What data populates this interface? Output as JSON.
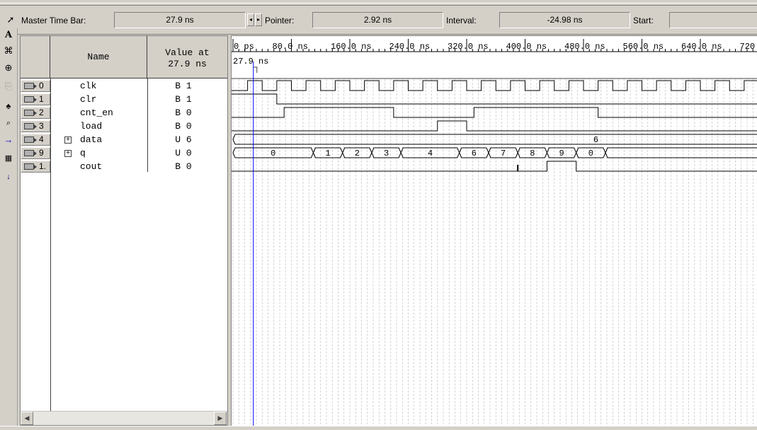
{
  "header": {
    "master_time_bar_label": "Master Time Bar:",
    "master_time_bar_value": "27.9 ns",
    "pointer_label": "Pointer:",
    "pointer_value": "2.92 ns",
    "interval_label": "Interval:",
    "interval_value": "-24.98 ns",
    "start_label": "Start:",
    "start_value": ""
  },
  "table": {
    "col_name": "Name",
    "col_value_line1": "Value at",
    "col_value_line2": "27.9 ns"
  },
  "signals": [
    {
      "index": "0",
      "name": "clk",
      "value": "B 1",
      "group": false
    },
    {
      "index": "1",
      "name": "clr",
      "value": "B 1",
      "group": false
    },
    {
      "index": "2",
      "name": "cnt_en",
      "value": "B 0",
      "group": false
    },
    {
      "index": "3",
      "name": "load",
      "value": "B 0",
      "group": false
    },
    {
      "index": "4",
      "name": "data",
      "value": "U 6",
      "group": true
    },
    {
      "index": "9",
      "name": "q",
      "value": "U 0",
      "group": true
    },
    {
      "index": "1.",
      "name": "cout",
      "value": "B 0",
      "group": false
    }
  ],
  "timeline": {
    "ticks": [
      "0 ps",
      "80.0 ns",
      "160.0 ns",
      "240.0 ns",
      "320.0 ns",
      "400.0 ns",
      "480.0 ns",
      "560.0 ns",
      "640.0 ns",
      "720."
    ],
    "cursor_label": "27.9 ns",
    "data_bus_value": "6",
    "q_bus_values": [
      "0",
      "1",
      "2",
      "3",
      "4",
      "6",
      "7",
      "8",
      "9",
      "0"
    ]
  },
  "colors": {
    "cursor": "#0000ff",
    "waveform": "#000000",
    "grid": "#b8b8b8",
    "panel_bg": "#d4d0c8"
  }
}
